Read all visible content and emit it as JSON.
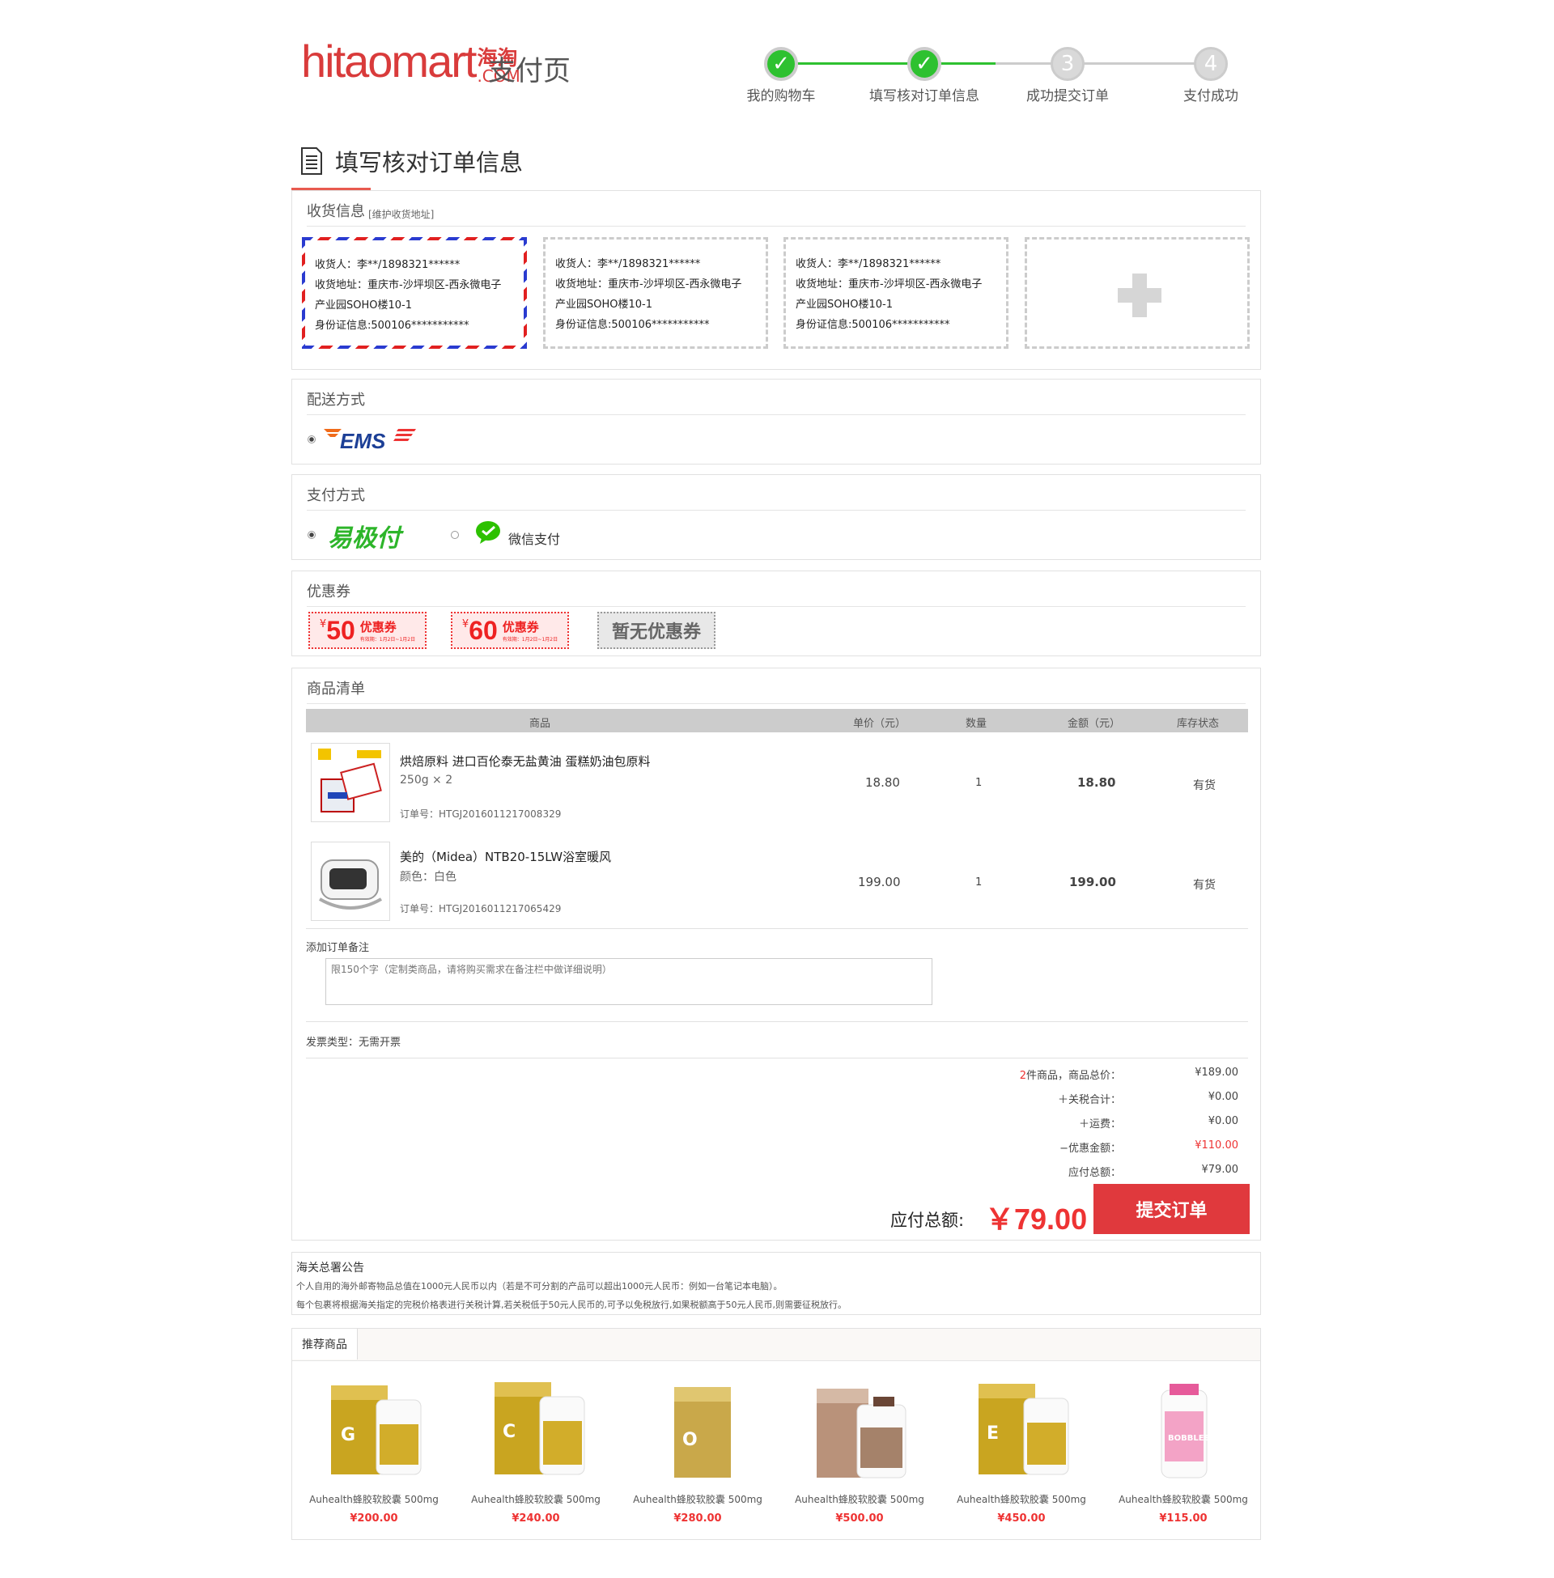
{
  "header": {
    "logo_main": "hitaomart",
    "logo_cn": "海淘",
    "logo_com": ".COM",
    "page_name": "支付页"
  },
  "steps": [
    {
      "label": "我的购物车",
      "marker": "✓",
      "state": "done"
    },
    {
      "label": "填写核对订单信息",
      "marker": "✓",
      "state": "done"
    },
    {
      "label": "成功提交订单",
      "marker": "3",
      "state": "todo"
    },
    {
      "label": "支付成功",
      "marker": "4",
      "state": "todo"
    }
  ],
  "section_title": "填写核对订单信息",
  "shipping_info": {
    "title": "收货信息",
    "manage_link": "[维护收货地址]",
    "addresses": [
      {
        "receiver": "收货人：李**/1898321******",
        "address1": "收货地址：重庆市-沙坪坝区-西永微电子",
        "address2": "产业园SOHO楼10-1",
        "id": "身份证信息:500106***********",
        "selected": true
      },
      {
        "receiver": "收货人：李**/1898321******",
        "address1": "收货地址：重庆市-沙坪坝区-西永微电子",
        "address2": "产业园SOHO楼10-1",
        "id": "身份证信息:500106***********",
        "selected": false
      },
      {
        "receiver": "收货人：李**/1898321******",
        "address1": "收货地址：重庆市-沙坪坝区-西永微电子",
        "address2": "产业园SOHO楼10-1",
        "id": "身份证信息:500106***********",
        "selected": false
      }
    ],
    "add_icon": "plus-icon"
  },
  "delivery": {
    "title": "配送方式",
    "option": "EMS"
  },
  "payment": {
    "title": "支付方式",
    "options": [
      {
        "label": "易极付",
        "selected": true
      },
      {
        "label": "微信支付",
        "selected": false
      }
    ]
  },
  "coupons": {
    "title": "优惠券",
    "items": [
      {
        "currency": "¥",
        "amount": "50",
        "label": "优惠券",
        "validity": "有效期：1月2日~1月2日"
      },
      {
        "currency": "¥",
        "amount": "60",
        "label": "优惠券",
        "validity": "有效期：1月2日~1月2日"
      }
    ],
    "none_label": "暂无优惠券"
  },
  "product_list": {
    "title": "商品清单",
    "columns": [
      "商品",
      "单价（元）",
      "数量",
      "金额（元）",
      "库存状态"
    ],
    "items": [
      {
        "name": "烘焙原料  进口百伦泰无盐黄油  蛋糕奶油包原料",
        "spec": "250g  × 2",
        "order_no": "订单号：HTGJ2016011217008329",
        "price": "18.80",
        "qty": "1",
        "amount": "18.80",
        "stock": "有货"
      },
      {
        "name": "美的（Midea）NTB20-15LW浴室暖风",
        "spec": "颜色：白色",
        "order_no": "订单号：HTGJ2016011217065429",
        "price": "199.00",
        "qty": "1",
        "amount": "199.00",
        "stock": "有货"
      }
    ],
    "remark_label": "添加订单备注",
    "remark_placeholder": "限150个字（定制类商品，请将购买需求在备注栏中做详细说明）",
    "invoice": "发票类型：无需开票"
  },
  "summary": {
    "count": "2",
    "count_suffix": "件商品，商品总价：",
    "goods_total": "¥189.00",
    "tax_label": "＋关税合计：",
    "tax": "¥0.00",
    "freight_label": "＋运费：",
    "freight": "¥0.00",
    "discount_label": "−优惠金额：",
    "discount": "¥110.00",
    "payable_label": "应付总额：",
    "payable": "¥79.00",
    "big_label": "应付总额:",
    "big_amount": "￥79.00",
    "submit": "提交订单"
  },
  "customs": {
    "title": "海关总署公告",
    "line1": "个人自用的海外邮寄物品总值在1000元人民币以内（若是不可分割的产品可以超出1000元人民币：例如一台笔记本电脑）。",
    "line2": "每个包裹将根据海关指定的完税价格表进行关税计算,若关税低于50元人民币的,可予以免税放行,如果税额高于50元人民币,则需要征税放行。"
  },
  "recommend": {
    "tab": "推荐商品",
    "products": [
      {
        "name": "Auhealth蜂胶软胶囊 500mg",
        "price": "¥200.00",
        "box_letter": "G"
      },
      {
        "name": "Auhealth蜂胶软胶囊 500mg",
        "price": "¥240.00",
        "box_letter": "C"
      },
      {
        "name": "Auhealth蜂胶软胶囊 500mg",
        "price": "¥280.00",
        "box_letter": "O"
      },
      {
        "name": "Auhealth蜂胶软胶囊 500mg",
        "price": "¥500.00",
        "box_letter": ""
      },
      {
        "name": "Auhealth蜂胶软胶囊 500mg",
        "price": "¥450.00",
        "box_letter": "E"
      },
      {
        "name": "Auhealth蜂胶软胶囊 500mg",
        "price": "¥115.00",
        "box_letter": "BOBBLES"
      }
    ]
  },
  "colors": {
    "accent": "#e0393d",
    "success": "#2ec130",
    "wechat": "#2dc100"
  }
}
